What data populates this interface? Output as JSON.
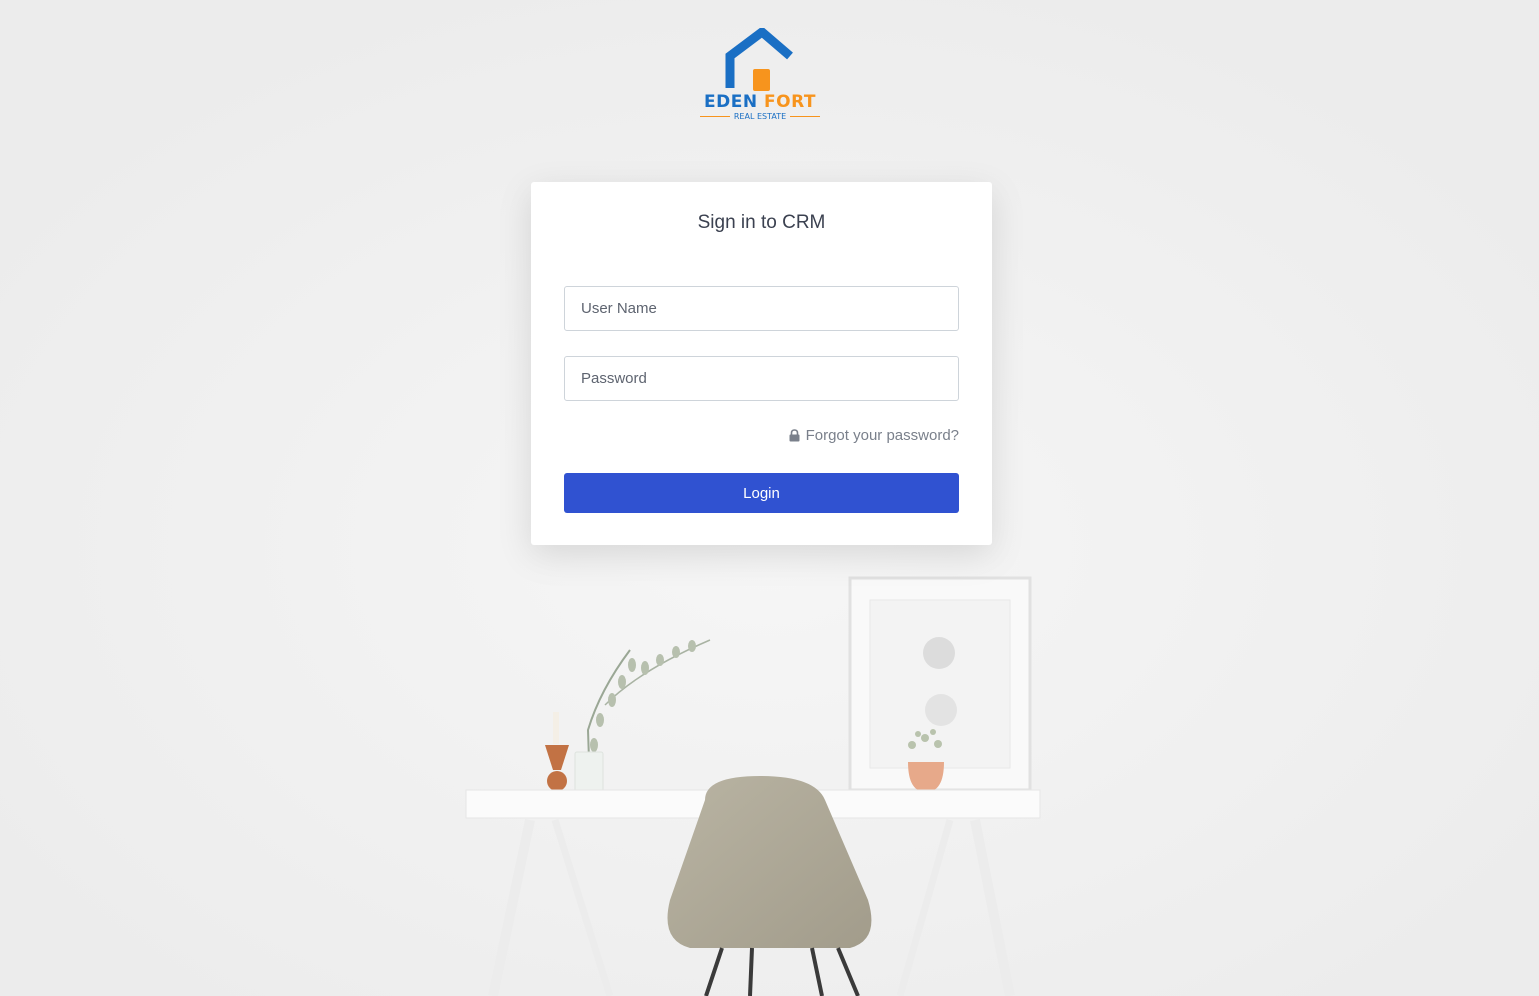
{
  "brand": {
    "name_part1": "EDEN",
    "name_part2": "FORT",
    "tagline": "REAL ESTATE",
    "colors": {
      "blue": "#1a6fc4",
      "orange": "#f7941d"
    }
  },
  "login_form": {
    "title": "Sign in to CRM",
    "username_placeholder": "User Name",
    "username_value": "",
    "password_placeholder": "Password",
    "password_value": "",
    "forgot_icon": "lock-icon",
    "forgot_label": "Forgot your password?",
    "submit_label": "Login",
    "accent_color": "#3052d1"
  }
}
